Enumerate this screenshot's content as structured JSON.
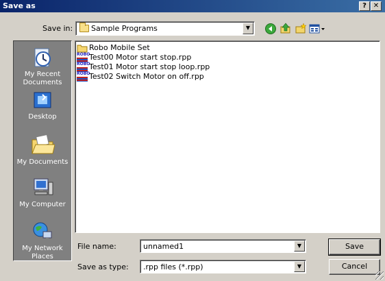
{
  "window": {
    "title": "Save as",
    "help_label": "?",
    "close_label": "✕"
  },
  "toolbar": {
    "save_in_label": "Save in:",
    "save_in_value": "Sample Programs",
    "icons": [
      "back-icon",
      "up-folder-icon",
      "new-folder-icon",
      "views-menu-icon"
    ]
  },
  "places": [
    {
      "label": "My Recent Documents",
      "icon": "recent-documents-icon"
    },
    {
      "label": "Desktop",
      "icon": "desktop-icon"
    },
    {
      "label": "My Documents",
      "icon": "my-documents-icon"
    },
    {
      "label": "My Computer",
      "icon": "my-computer-icon"
    },
    {
      "label": "My Network Places",
      "icon": "network-places-icon"
    }
  ],
  "files": [
    {
      "name": "Robo Mobile Set",
      "type": "folder",
      "icon": "folder-icon"
    },
    {
      "name": "Test00 Motor start stop.rpp",
      "type": "rpp",
      "icon": "robo-file-icon"
    },
    {
      "name": "Test01 Motor start stop loop.rpp",
      "type": "rpp",
      "icon": "robo-file-icon"
    },
    {
      "name": "Test02 Switch Motor on off.rpp",
      "type": "rpp",
      "icon": "robo-file-icon"
    }
  ],
  "form": {
    "file_name_label": "File name:",
    "file_name_value": "unnamed1",
    "save_as_type_label": "Save as type:",
    "save_as_type_value": ".rpp files (*.rpp)",
    "save_label": "Save",
    "cancel_label": "Cancel"
  },
  "file_icon_text": "ROBO"
}
